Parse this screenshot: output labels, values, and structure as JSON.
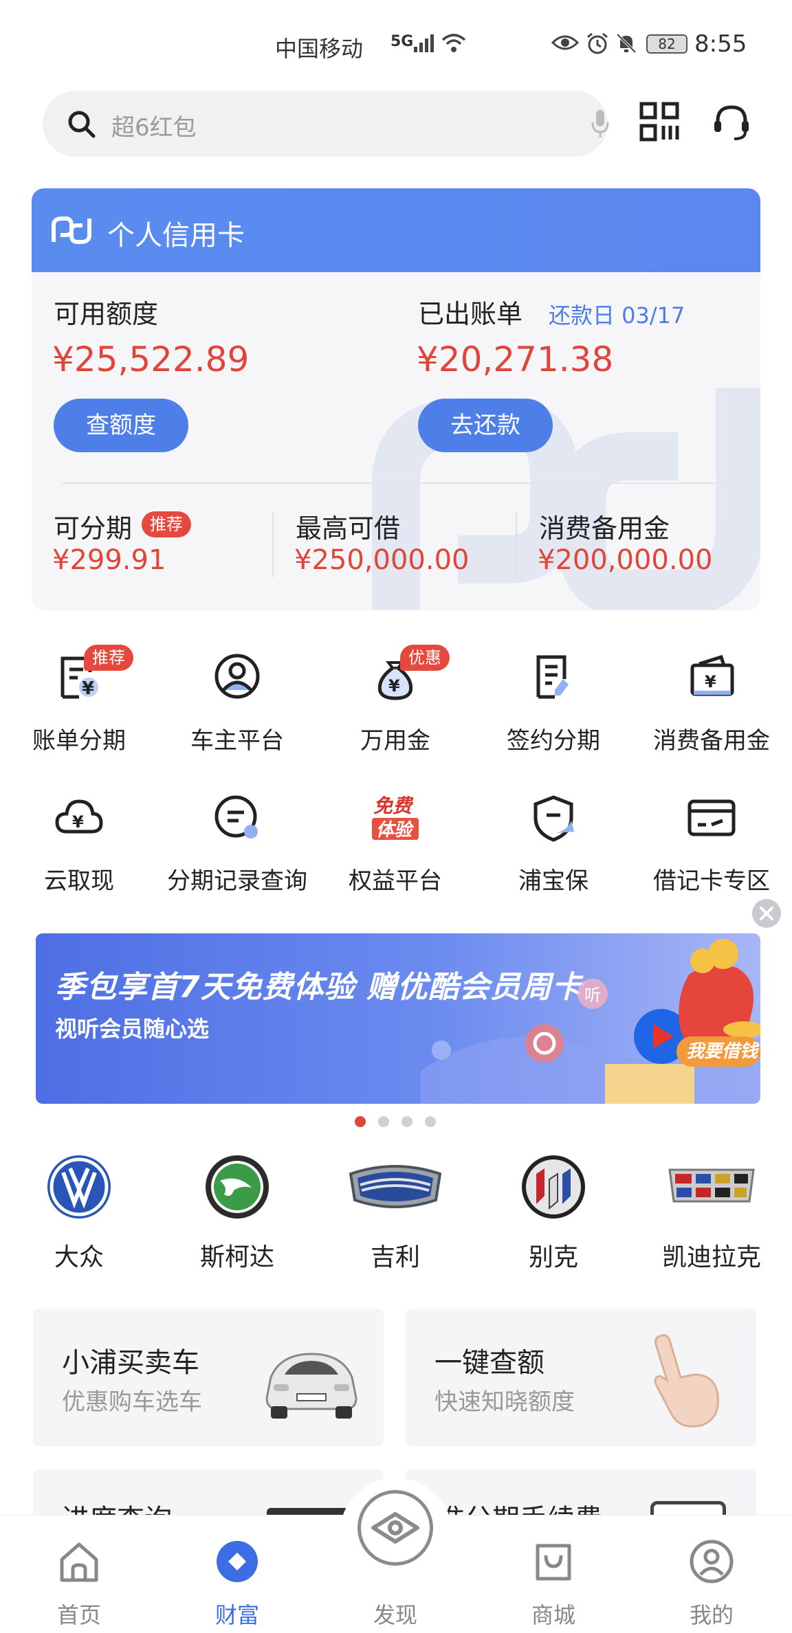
{
  "status_bar": {
    "carrier": "中国移动",
    "network": "5G",
    "battery": "82",
    "time": "8:55"
  },
  "search": {
    "placeholder": "超6红包"
  },
  "credit_card": {
    "title": "个人信用卡",
    "available_label": "可用额度",
    "available_amount": "¥25,522.89",
    "check_limit_button": "查额度",
    "bill_label": "已出账单",
    "due_label": "还款日 03/17",
    "bill_amount": "¥20,271.38",
    "repay_button": "去还款",
    "installment_label": "可分期",
    "installment_tag": "推荐",
    "installment_amount": "¥299.91",
    "max_borrow_label": "最高可借",
    "max_borrow_amount": "¥250,000.00",
    "reserve_label": "消费备用金",
    "reserve_amount": "¥200,000.00"
  },
  "services": [
    {
      "label": "账单分期",
      "badge": "推荐",
      "icon": "bill-installment-icon"
    },
    {
      "label": "车主平台",
      "badge": "",
      "icon": "car-owner-icon"
    },
    {
      "label": "万用金",
      "badge": "优惠",
      "icon": "money-bag-icon"
    },
    {
      "label": "签约分期",
      "badge": "",
      "icon": "contract-icon"
    },
    {
      "label": "消费备用金",
      "badge": "",
      "icon": "wallet-icon"
    },
    {
      "label": "云取现",
      "badge": "",
      "icon": "cloud-cash-icon"
    },
    {
      "label": "分期记录查询",
      "badge": "",
      "icon": "record-search-icon"
    },
    {
      "label": "权益平台",
      "badge": "",
      "icon": "free-trial-icon",
      "icon_text_top": "免费",
      "icon_text_bottom": "体验"
    },
    {
      "label": "浦宝保",
      "badge": "",
      "icon": "shield-icon"
    },
    {
      "label": "借记卡专区",
      "badge": "",
      "icon": "debit-card-icon"
    }
  ],
  "banner": {
    "headline": "季包享首7天免费体验 赠优酷会员周卡",
    "subline": "视听会员随心选",
    "cta": "我要借钱",
    "tag": "听"
  },
  "car_brands": [
    "大众",
    "斯柯达",
    "吉利",
    "别克",
    "凯迪拉克"
  ],
  "feature_cards": [
    {
      "title": "小浦买卖车",
      "subtitle": "优惠购车选车"
    },
    {
      "title": "一键查额",
      "subtitle": "快速知晓额度"
    }
  ],
  "partial_cards": [
    {
      "title": "进度查询"
    },
    {
      "title": "标准分期手续费"
    }
  ],
  "bottom_nav": [
    {
      "label": "首页",
      "active": false
    },
    {
      "label": "财富",
      "active": true
    },
    {
      "label": "发现",
      "active": false
    },
    {
      "label": "商城",
      "active": false
    },
    {
      "label": "我的",
      "active": false
    }
  ],
  "colors": {
    "brand_blue": "#4e7fe9",
    "amount_red": "#e0453a",
    "nav_active": "#3d6de4"
  }
}
